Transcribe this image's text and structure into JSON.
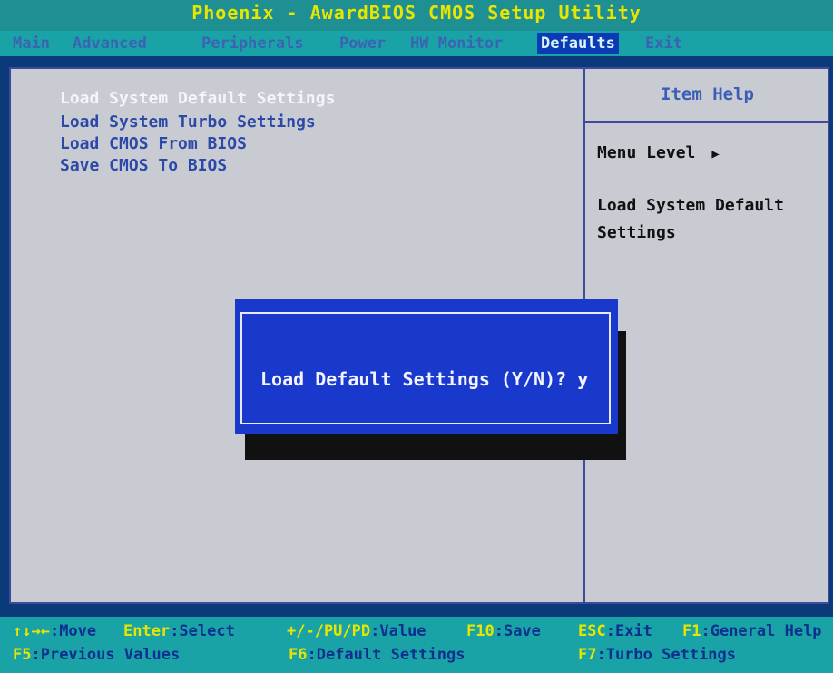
{
  "title": "Phoenix - AwardBIOS CMOS Setup Utility",
  "menu": [
    "Main",
    "Advanced",
    "Peripherals",
    "Power",
    "HW Monitor",
    "Defaults",
    "Exit"
  ],
  "menu_active": "Defaults",
  "options": [
    "Load System Default Settings",
    "Load System Turbo Settings",
    "Load CMOS From BIOS",
    "Save CMOS To BIOS"
  ],
  "help": {
    "title": "Item Help",
    "menu_level": "Menu Level",
    "arrow": "▶",
    "description": "Load System Default Settings"
  },
  "dialog": {
    "message": "Load Default Settings (Y/N)? y"
  },
  "footer": [
    {
      "key": "↑↓→←",
      "desc": ":Move"
    },
    {
      "key": "Enter",
      "desc": ":Select"
    },
    {
      "key": "+/-/PU/PD",
      "desc": ":Value"
    },
    {
      "key": "F10",
      "desc": ":Save"
    },
    {
      "key": "ESC",
      "desc": ":Exit"
    },
    {
      "key": "F1",
      "desc": ":General Help"
    },
    {
      "key": "F5",
      "desc": ":Previous Values"
    },
    {
      "key": "F6",
      "desc": ":Default Settings"
    },
    {
      "key": "F7",
      "desc": ":Turbo Settings"
    }
  ]
}
